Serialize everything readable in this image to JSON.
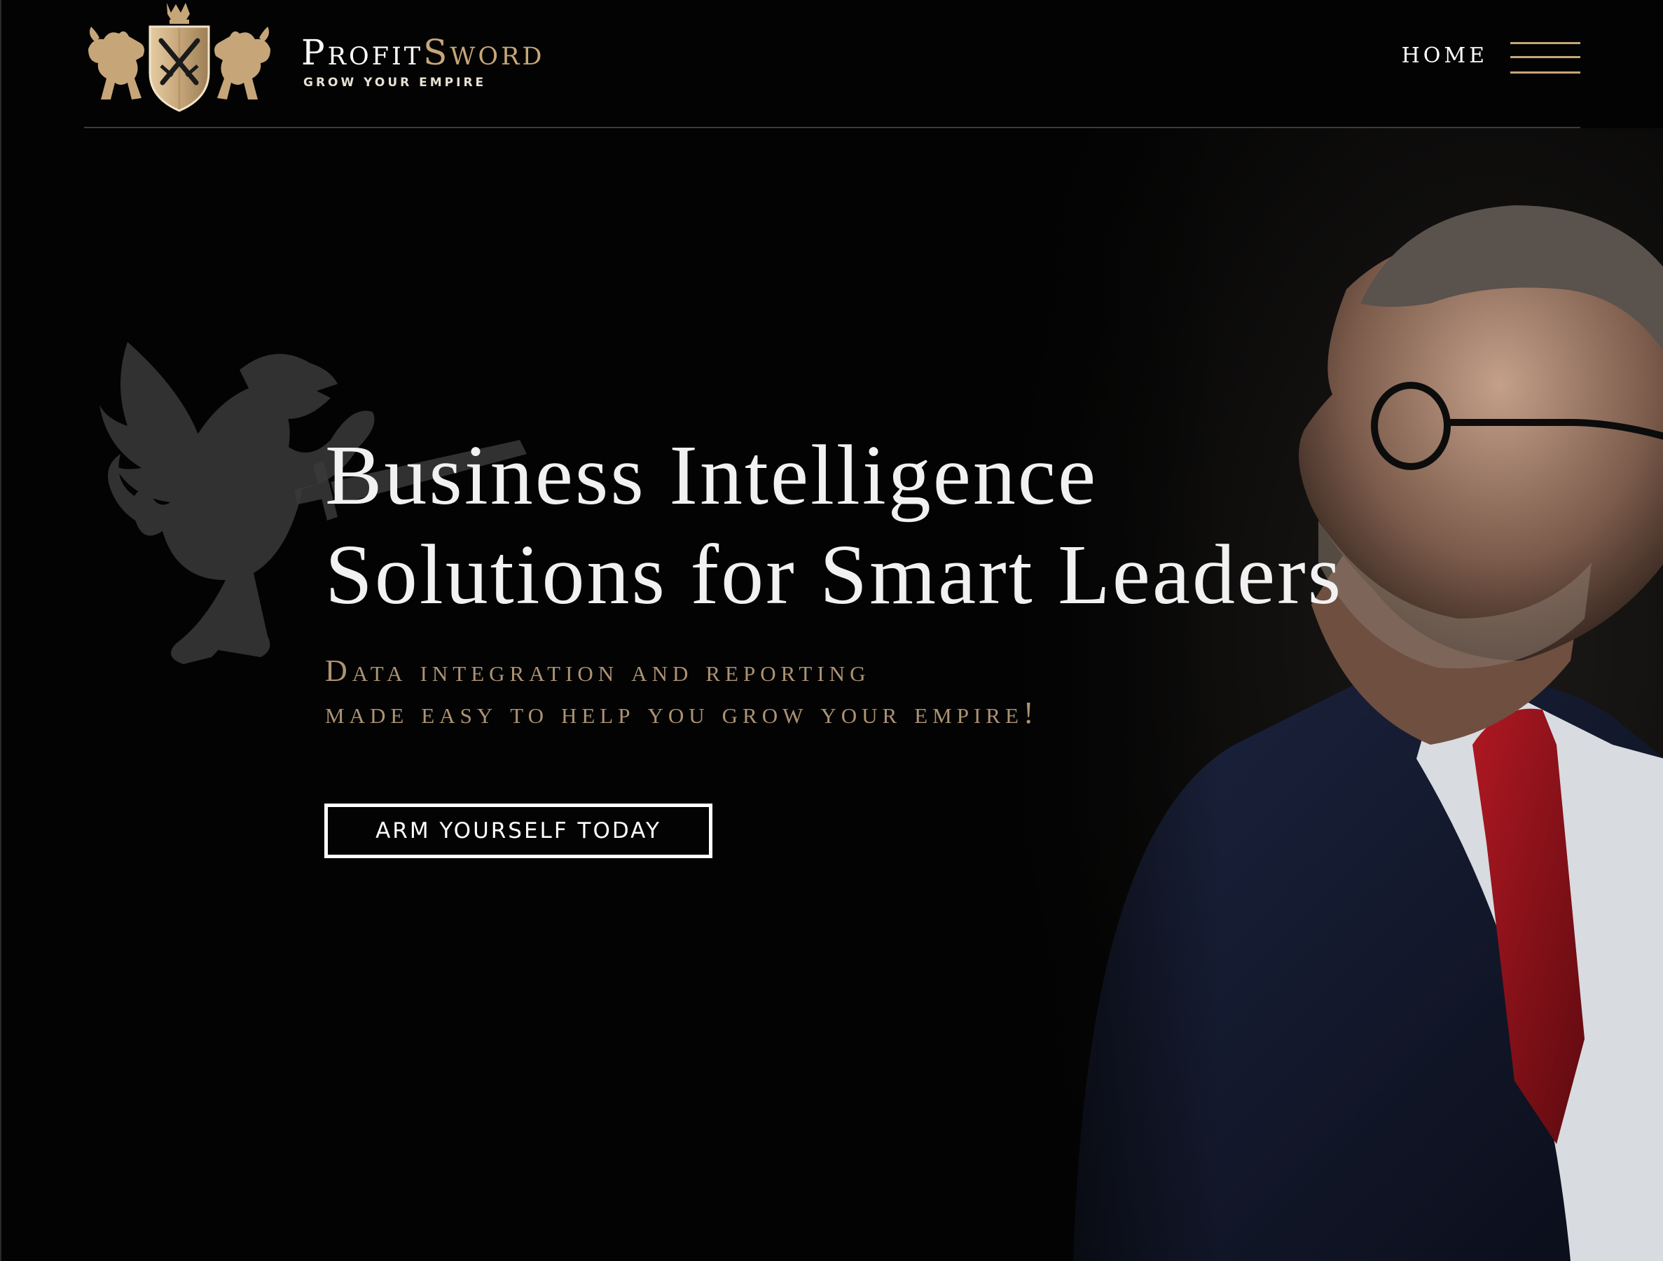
{
  "header": {
    "brand_profit": "ProfitSword",
    "brand_tagline": "GROW YOUR EMPIRE",
    "nav_home": "HOME",
    "menu_icon": "hamburger-menu-icon"
  },
  "hero": {
    "headline_line1": "Business Intelligence",
    "headline_line2": "Solutions for Smart Leaders",
    "subhead_line1": "Data integration and reporting",
    "subhead_line2": "made easy to help you grow your empire!",
    "cta_label": "ARM YOURSELF TODAY",
    "background_image": "businessman-portrait-photo",
    "watermark_icon": "griffin-icon"
  },
  "colors": {
    "background": "#030303",
    "gold_accent": "#c6a679",
    "subhead_gold": "#ad9373",
    "text_white": "#f1f1f1",
    "divider": "#3c3c3c"
  }
}
